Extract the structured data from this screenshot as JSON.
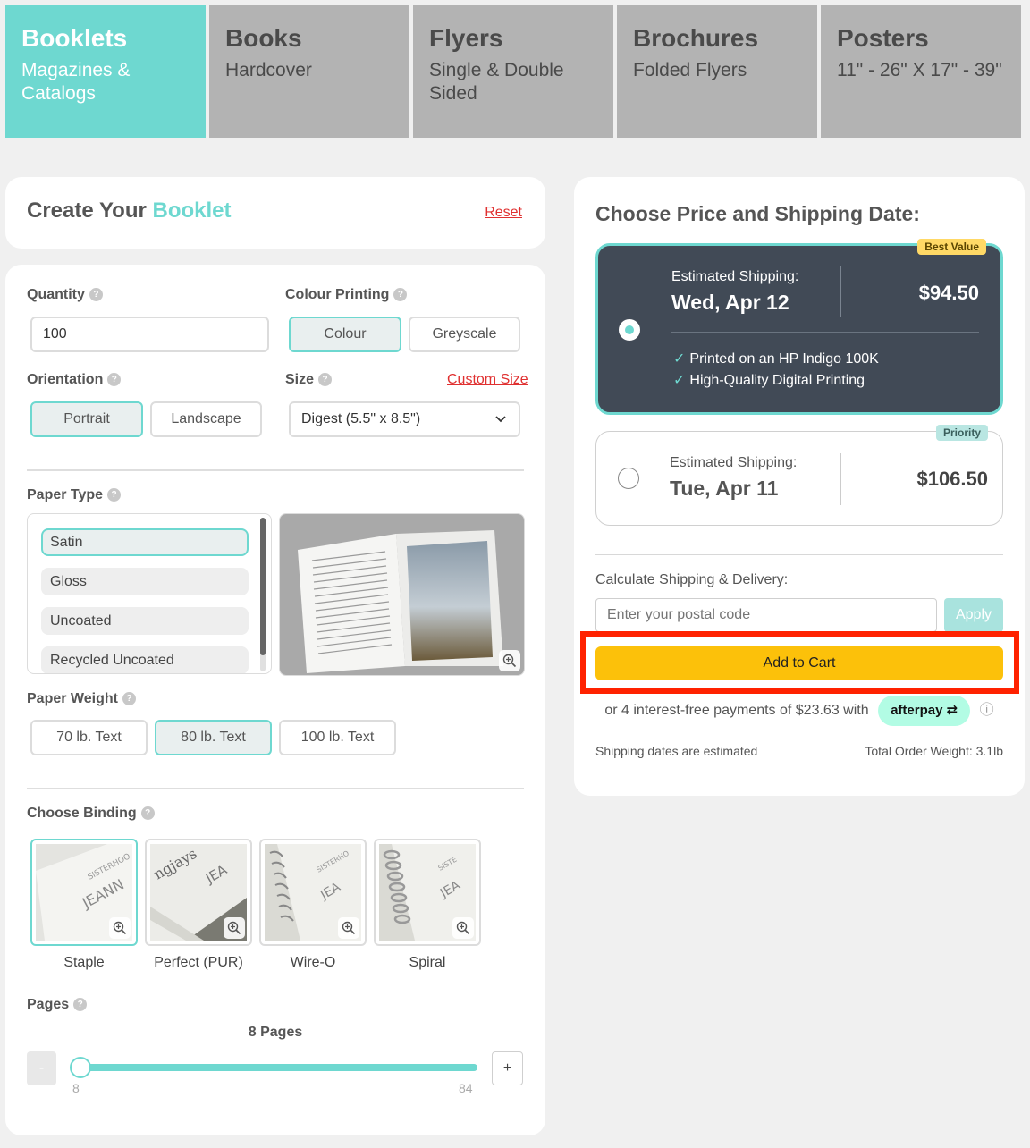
{
  "tabs": [
    {
      "title": "Booklets",
      "subtitle": "Magazines & Catalogs"
    },
    {
      "title": "Books",
      "subtitle": "Hardcover"
    },
    {
      "title": "Flyers",
      "subtitle": "Single & Double Sided"
    },
    {
      "title": "Brochures",
      "subtitle": "Folded Flyers"
    },
    {
      "title": "Posters",
      "subtitle": "11\" - 26\" X 17\" - 39\""
    }
  ],
  "create": {
    "title_prefix": "Create Your",
    "title_accent": "Booklet",
    "reset_label": "Reset"
  },
  "form": {
    "help_glyph": "?",
    "quantity": {
      "label": "Quantity",
      "value": "100"
    },
    "colour": {
      "label": "Colour Printing",
      "options": [
        "Colour",
        "Greyscale"
      ],
      "selected": "Colour"
    },
    "orientation": {
      "label": "Orientation",
      "options": [
        "Portrait",
        "Landscape"
      ],
      "selected": "Portrait"
    },
    "size": {
      "label": "Size",
      "custom_link": "Custom Size",
      "selected": "Digest (5.5\" x 8.5\")"
    },
    "paper_type": {
      "label": "Paper Type",
      "options": [
        "Satin",
        "Gloss",
        "Uncoated",
        "Recycled Uncoated"
      ],
      "selected": "Satin"
    },
    "paper_weight": {
      "label": "Paper Weight",
      "options": [
        "70 lb. Text",
        "80 lb. Text",
        "100 lb. Text"
      ],
      "selected": "80 lb. Text"
    },
    "binding": {
      "label": "Choose Binding",
      "options": [
        "Staple",
        "Perfect (PUR)",
        "Wire-O",
        "Spiral"
      ],
      "selected": "Staple"
    },
    "pages": {
      "label": "Pages",
      "display": "8 Pages",
      "min": "8",
      "max": "84",
      "value": 8,
      "minus": "-",
      "plus": "+"
    }
  },
  "pricing": {
    "title": "Choose Price and Shipping Date:",
    "options": [
      {
        "badge": "Best Value",
        "est_label": "Estimated Shipping:",
        "date": "Wed, Apr 12",
        "price": "$94.50",
        "selected": true,
        "features": [
          "Printed on an HP Indigo 100K",
          "High-Quality Digital Printing"
        ]
      },
      {
        "badge": "Priority",
        "est_label": "Estimated Shipping:",
        "date": "Tue, Apr 11",
        "price": "$106.50",
        "selected": false
      }
    ],
    "calc_label": "Calculate Shipping & Delivery:",
    "postal_placeholder": "Enter your postal code",
    "apply_label": "Apply",
    "cart_label": "Add to Cart",
    "installment_text": "or 4 interest-free payments of $23.63 with",
    "afterpay_label": "afterpay",
    "info_glyph": "ⓘ",
    "ship_note": "Shipping dates are estimated",
    "weight_note": "Total Order Weight: 3.1lb"
  },
  "colors": {
    "accent": "#6ed8d0",
    "dark_card": "#414a56",
    "cart": "#fcc10a",
    "highlight": "#ff2200",
    "reset": "#e03030",
    "afterpay": "#b2fce4"
  }
}
